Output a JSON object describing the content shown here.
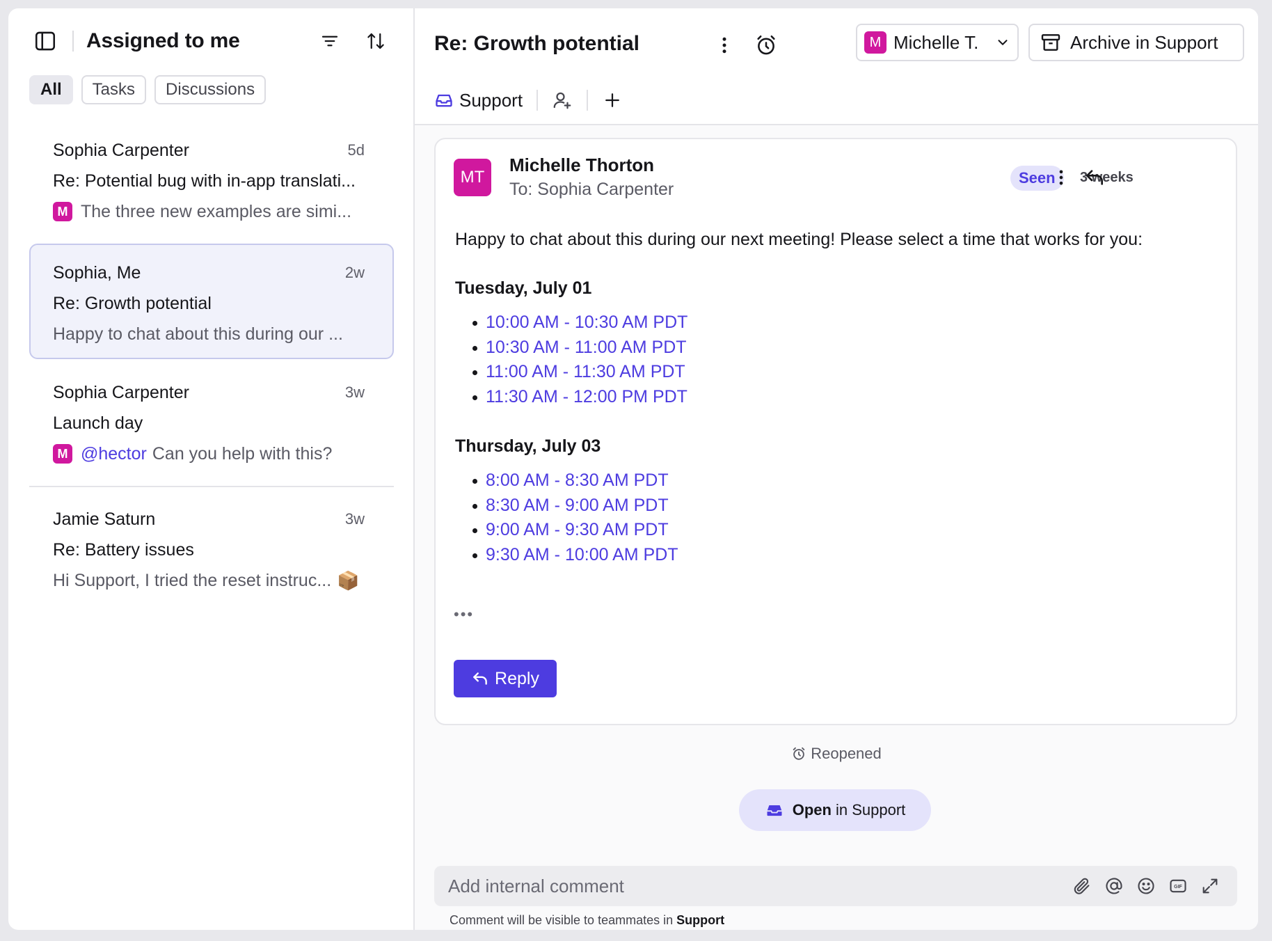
{
  "left": {
    "title": "Assigned to me",
    "tabs": [
      "All",
      "Tasks",
      "Discussions"
    ],
    "active_tab": "All",
    "items": [
      {
        "name": "Sophia Carpenter",
        "time": "5d",
        "subject": "Re: Potential bug with in-app translati...",
        "preview": "The three new examples are simi...",
        "badge": "M"
      },
      {
        "name": "Sophia, Me",
        "time": "2w",
        "subject": "Re: Growth potential",
        "preview": "Happy to chat about this during our ..."
      },
      {
        "name": "Sophia Carpenter",
        "time": "3w",
        "subject": "Launch day",
        "mention": "@hector",
        "preview": "Can you help with this?",
        "badge": "M"
      },
      {
        "name": "Jamie Saturn",
        "time": "3w",
        "subject": "Re: Battery issues",
        "preview": "Hi Support, I tried the reset instruc...",
        "emoji": "📦"
      }
    ]
  },
  "header": {
    "title": "Re: Growth potential",
    "assignee_badge": "M",
    "assignee": "Michelle T.",
    "archive_label": "Archive in Support",
    "inbox": "Support"
  },
  "message": {
    "avatar": "MT",
    "sender": "Michelle Thorton",
    "to": "To: Sophia Carpenter",
    "seen": "Seen",
    "when": "3 weeks",
    "body": "Happy to chat about this during our next meeting! Please select a time that works for you:",
    "days": [
      {
        "label": "Tuesday, July 01",
        "slots": [
          "10:00 AM - 10:30 AM PDT",
          "10:30 AM - 11:00 AM PDT",
          "11:00 AM - 11:30 AM PDT",
          "11:30 AM - 12:00 PM PDT"
        ]
      },
      {
        "label": "Thursday, July 03",
        "slots": [
          "8:00 AM - 8:30 AM PDT",
          "8:30 AM - 9:00 AM PDT",
          "9:00 AM - 9:30 AM PDT",
          "9:30 AM - 10:00 AM PDT"
        ]
      }
    ],
    "ellipsis": "•••",
    "reply_label": "Reply"
  },
  "timeline": {
    "event": "Reopened",
    "open_bold": "Open",
    "open_rest": "in Support"
  },
  "composer": {
    "placeholder": "Add internal comment",
    "hint_prefix": "Comment will be visible to teammates in",
    "hint_inbox": "Support"
  },
  "colors": {
    "accent": "#4d3ce0",
    "badge": "#d0189e",
    "seen_bg": "#e4e3fb"
  }
}
